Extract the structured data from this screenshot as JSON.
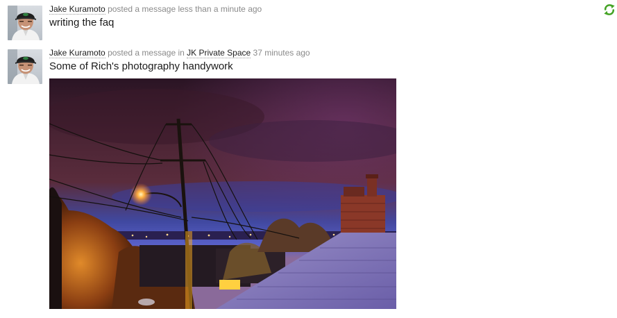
{
  "refresh": {
    "icon": "refresh-icon",
    "color": "#44a325"
  },
  "posts": [
    {
      "author": "Jake Kuramoto",
      "action": "posted a message",
      "location_prefix": "",
      "location": "",
      "time": "less than a minute ago",
      "text": "writing the faq",
      "has_photo": false
    },
    {
      "author": "Jake Kuramoto",
      "action": "posted a message",
      "location_prefix": "in",
      "location": "JK Private Space",
      "time": "37 minutes ago",
      "text": "Some of Rich's photography handywork",
      "has_photo": true
    }
  ]
}
